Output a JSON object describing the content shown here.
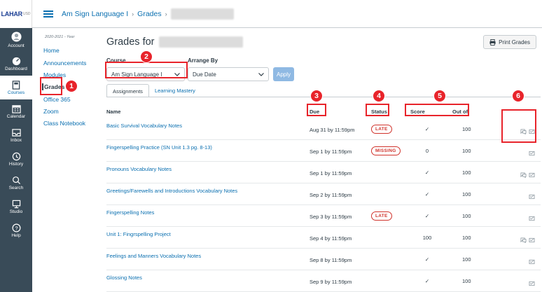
{
  "global_nav": {
    "logo_text": "LAHAR",
    "logo_suffix": "USD",
    "items": [
      {
        "label": "Account",
        "icon": "account-icon"
      },
      {
        "label": "Dashboard",
        "icon": "dashboard-icon"
      },
      {
        "label": "Courses",
        "icon": "courses-icon",
        "active": true
      },
      {
        "label": "Calendar",
        "icon": "calendar-icon"
      },
      {
        "label": "Inbox",
        "icon": "inbox-icon"
      },
      {
        "label": "History",
        "icon": "history-icon"
      },
      {
        "label": "Search",
        "icon": "search-icon"
      },
      {
        "label": "Studio",
        "icon": "studio-icon"
      },
      {
        "label": "Help",
        "icon": "help-icon"
      }
    ]
  },
  "header": {
    "course": "Am Sign Language I",
    "separator": "›",
    "page": "Grades",
    "separator2": "›"
  },
  "course_nav": {
    "term": "2020-2021 - Year",
    "items": [
      "Home",
      "Announcements",
      "Modules",
      "Grades",
      "Office 365",
      "Zoom",
      "Class Notebook"
    ]
  },
  "main": {
    "title": "Grades for",
    "print_label": "Print Grades",
    "course_label": "Course",
    "course_value": "Am Sign Language I",
    "arrange_label": "Arrange By",
    "arrange_value": "Due Date",
    "apply_label": "Apply",
    "tabs": [
      "Assignments",
      "Learning Mastery"
    ],
    "columns": {
      "name": "Name",
      "due": "Due",
      "status": "Status",
      "score": "Score",
      "outof": "Out of"
    }
  },
  "rows": [
    {
      "name": "Basic Survival Vocabulary Notes",
      "due": "Aug 31 by 11:59pm",
      "status": "LATE",
      "score": "✓",
      "outof": "100",
      "comment": true
    },
    {
      "name": "Fingerspelling Practice (SN Unit 1.3 pg. 8-13)",
      "due": "Sep 1 by 11:59pm",
      "status": "MISSING",
      "score": "0",
      "outof": "100",
      "comment": false
    },
    {
      "name": "Pronouns Vocabulary Notes",
      "due": "Sep 1 by 11:59pm",
      "status": "",
      "score": "✓",
      "outof": "100",
      "comment": true
    },
    {
      "name": "Greetings/Farewells and Introductions Vocabulary Notes",
      "due": "Sep 2 by 11:59pm",
      "status": "",
      "score": "✓",
      "outof": "100",
      "comment": false
    },
    {
      "name": "Fingerspelling Notes",
      "due": "Sep 3 by 11:59pm",
      "status": "LATE",
      "score": "✓",
      "outof": "100",
      "comment": false
    },
    {
      "name": "Unit 1: Fingrspelling Project",
      "due": "Sep 4 by 11:59pm",
      "status": "",
      "score": "100",
      "outof": "100",
      "comment": true
    },
    {
      "name": "Feelings and Manners Vocabulary Notes",
      "due": "Sep 8 by 11:59pm",
      "status": "",
      "score": "✓",
      "outof": "100",
      "comment": false
    },
    {
      "name": "Glossing Notes",
      "due": "Sep 9 by 11:59pm",
      "status": "",
      "score": "✓",
      "outof": "100",
      "comment": false
    }
  ],
  "callouts": [
    "1",
    "2",
    "3",
    "4",
    "5",
    "6"
  ],
  "colors": {
    "accent": "#0a6fb0",
    "nav_bg": "#394b58",
    "callout": "#e8242b",
    "late": "#d0322b"
  }
}
